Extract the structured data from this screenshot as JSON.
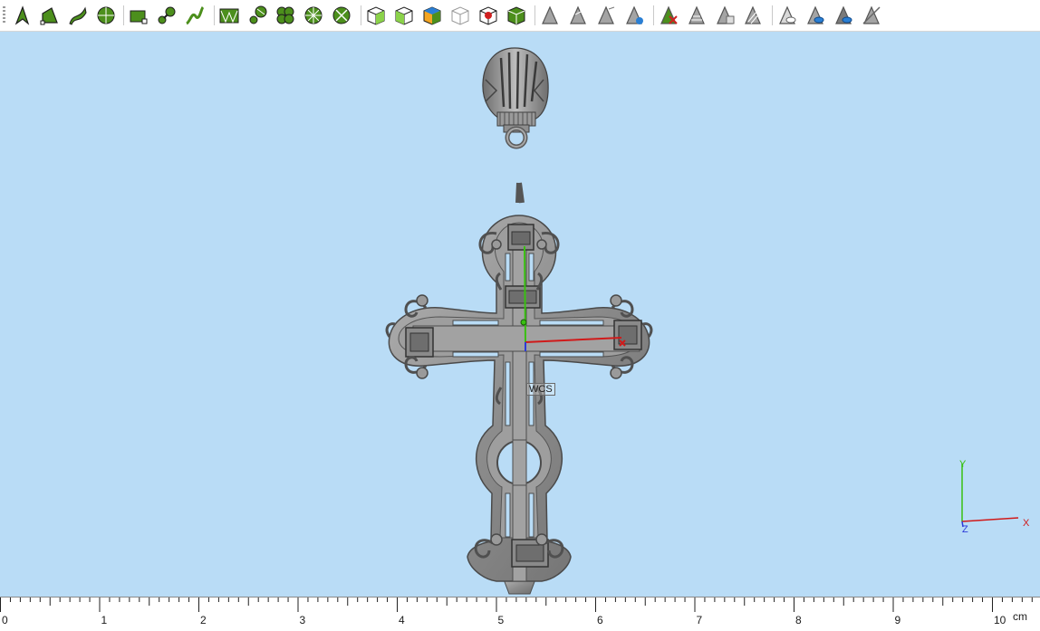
{
  "toolbar": {
    "buttons": [
      {
        "name": "select-tool-icon"
      },
      {
        "name": "draw-polyline-icon"
      },
      {
        "name": "draw-curve-icon"
      },
      {
        "name": "circle-grid-icon"
      },
      {
        "name": "rectangle-node-icon"
      },
      {
        "name": "node-link-icon"
      },
      {
        "name": "spline-icon"
      },
      {
        "name": "mesh-vector-icon"
      },
      {
        "name": "node-circle-icon"
      },
      {
        "name": "pattern-clover-icon"
      },
      {
        "name": "wheel-pattern-icon"
      },
      {
        "name": "wheel-cut-icon"
      },
      {
        "name": "box-view-icon"
      },
      {
        "name": "box-front-icon"
      },
      {
        "name": "box-color-icon"
      },
      {
        "name": "box-wire-icon"
      },
      {
        "name": "box-red-face-icon"
      },
      {
        "name": "box-green-icon"
      },
      {
        "name": "triangle-gray-1-icon"
      },
      {
        "name": "triangle-gray-2-icon"
      },
      {
        "name": "triangle-gray-3-icon"
      },
      {
        "name": "triangle-blue-icon"
      },
      {
        "name": "triangle-delete-icon"
      },
      {
        "name": "triangle-grid-icon"
      },
      {
        "name": "triangle-copy-icon"
      },
      {
        "name": "triangle-stripe-icon"
      },
      {
        "name": "triangle-eye-icon"
      },
      {
        "name": "triangle-eye-blue-icon"
      },
      {
        "name": "triangle-eye-dark-icon"
      },
      {
        "name": "triangle-slash-icon"
      }
    ]
  },
  "viewport": {
    "background": "#b9dcf6",
    "wcs_label": "WCS",
    "axis_labels": {
      "y": "Y",
      "z": "Z",
      "x": "X"
    },
    "model_color": "#8a8a8a"
  },
  "ruler": {
    "numbers": [
      "0",
      "1",
      "2",
      "3",
      "4",
      "5",
      "6",
      "7",
      "8",
      "9",
      "10"
    ],
    "unit": "cm"
  }
}
